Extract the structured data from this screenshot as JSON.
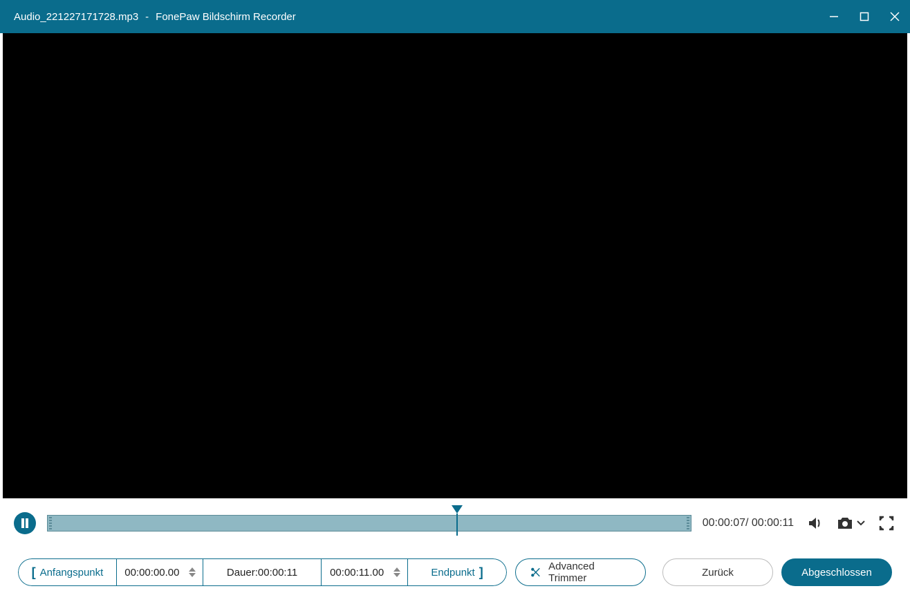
{
  "titlebar": {
    "filename": "Audio_221227171728.mp3",
    "separator": "-",
    "app_name": "FonePaw Bildschirm Recorder"
  },
  "player": {
    "current_time": "00:00:07",
    "total_time": "00:00:11",
    "progress_percent": 63.6
  },
  "trim": {
    "start_label": "Anfangspunkt",
    "start_time": "00:00:00.00",
    "duration_label": "Dauer:",
    "duration_value": "00:00:11",
    "end_time": "00:00:11.00",
    "end_label": "Endpunkt",
    "advanced_label": "Advanced Trimmer"
  },
  "actions": {
    "back": "Zurück",
    "done": "Abgeschlossen"
  }
}
